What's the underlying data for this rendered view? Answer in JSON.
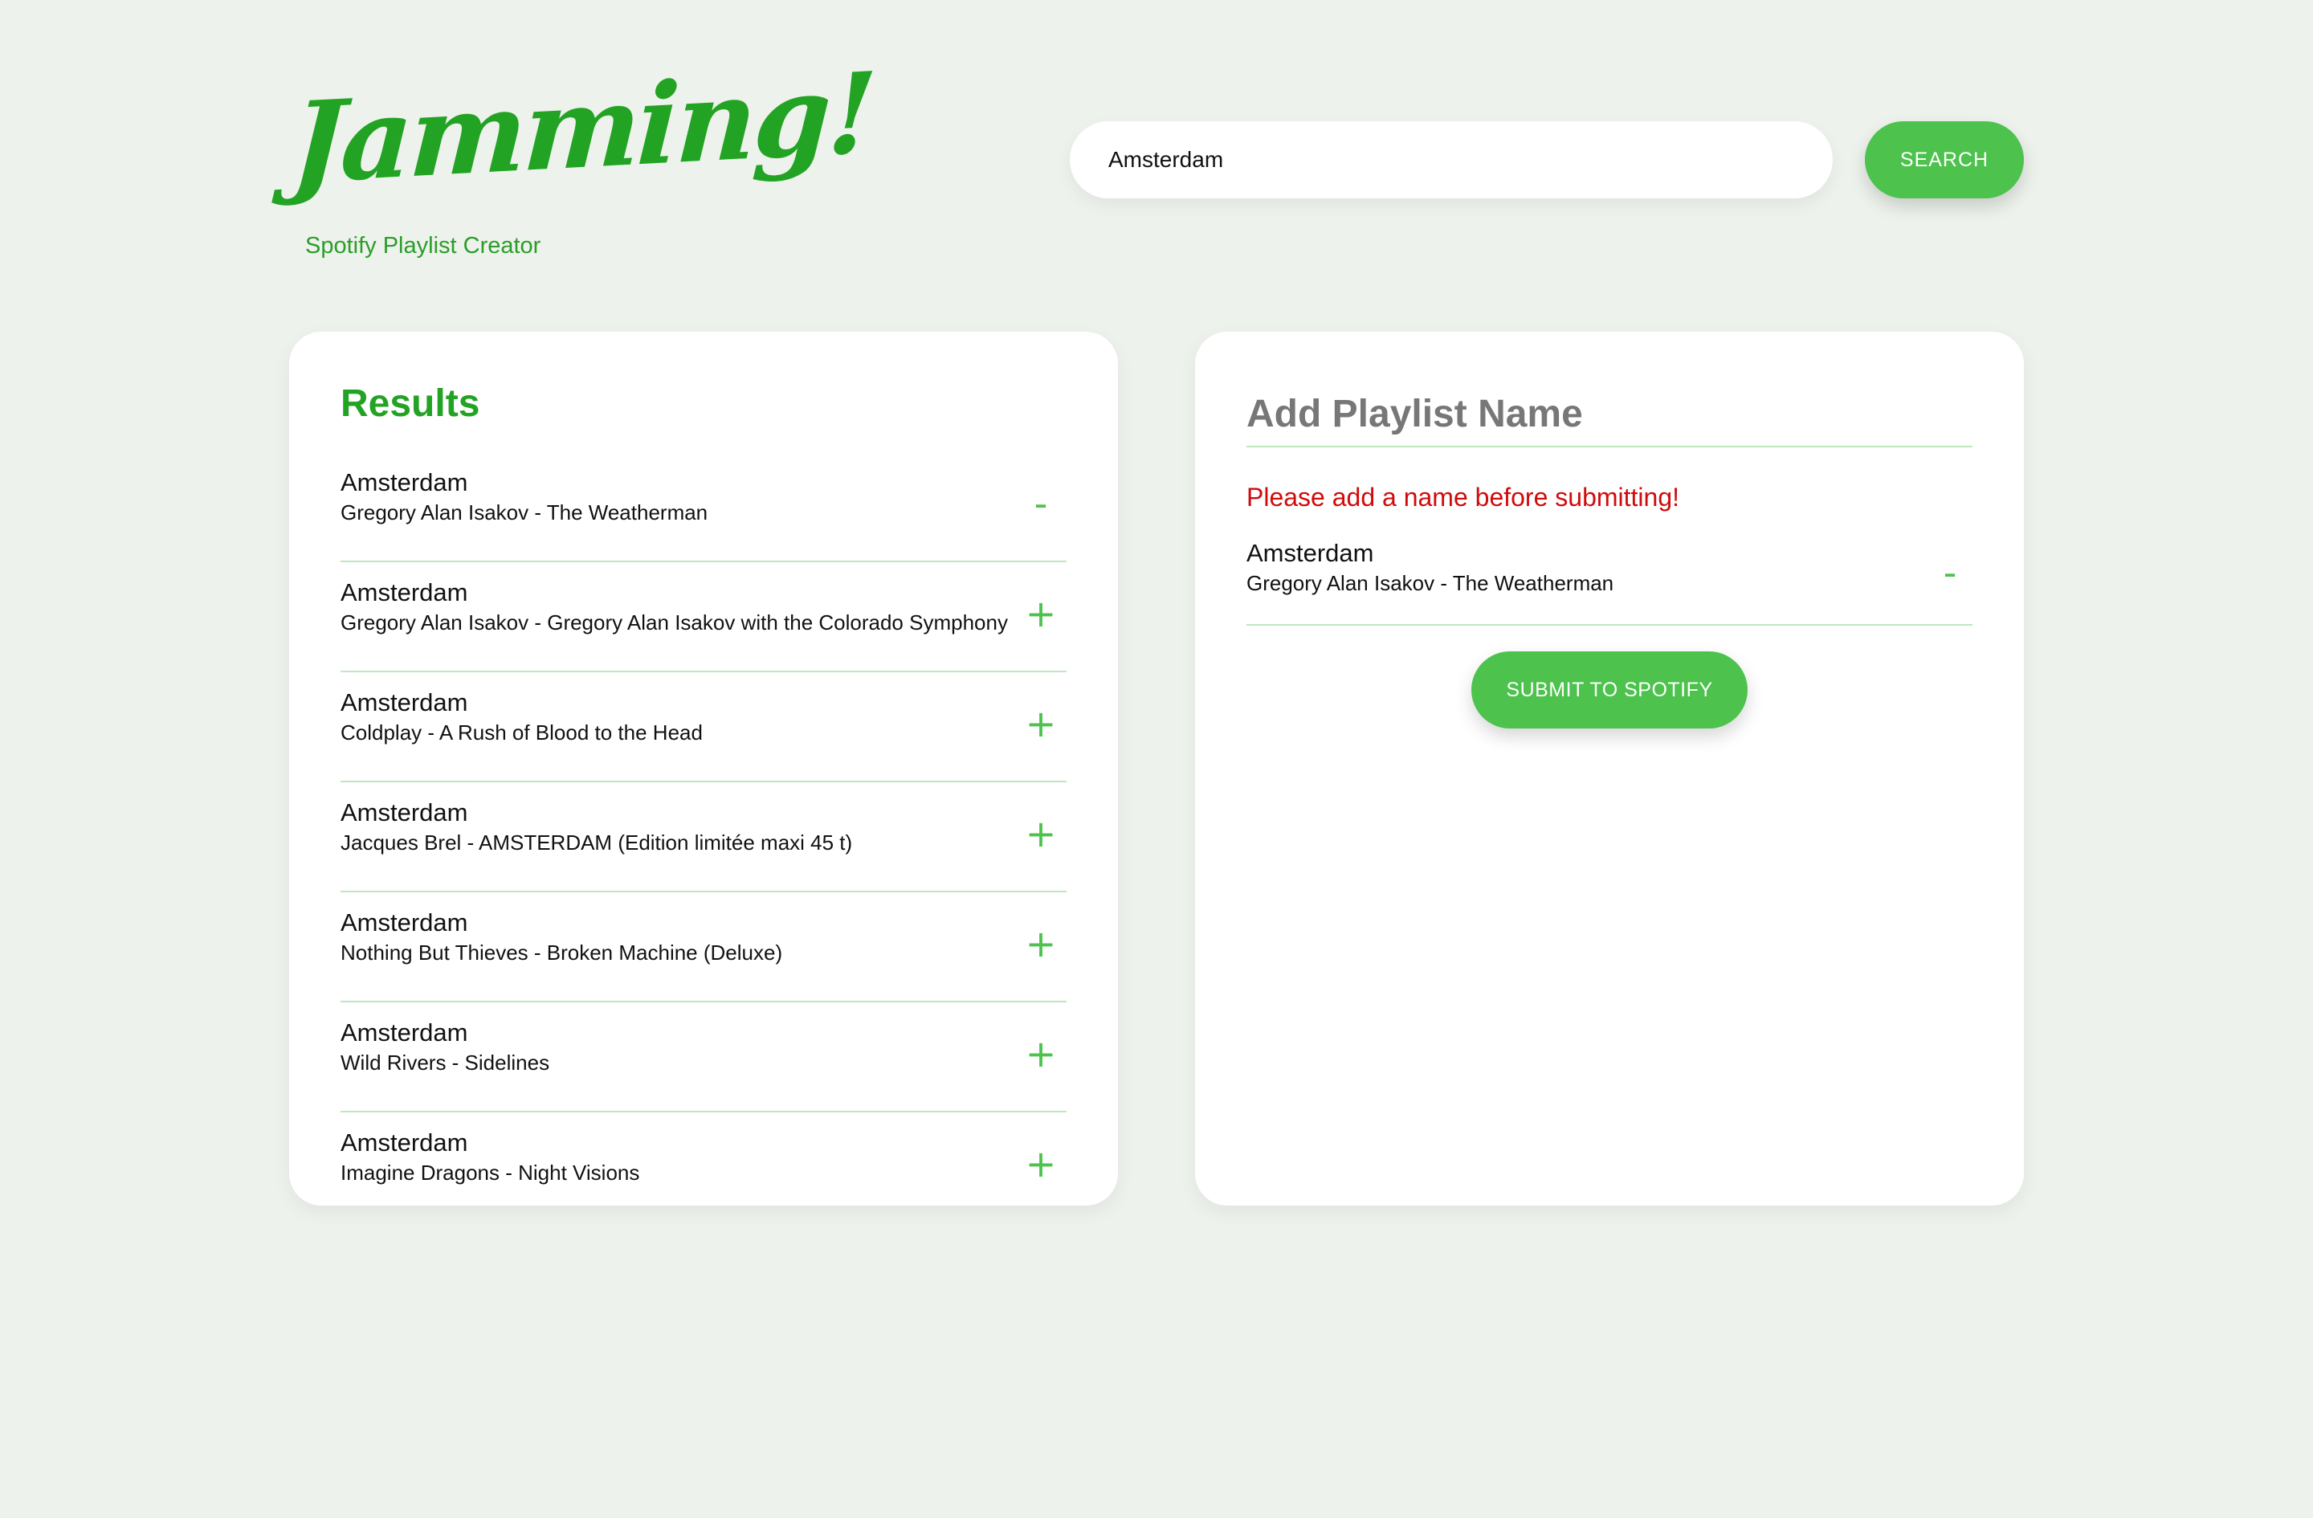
{
  "header": {
    "logo": "Jamming!",
    "tagline": "Spotify Playlist Creator"
  },
  "search": {
    "value": "Amsterdam",
    "button_label": "SEARCH"
  },
  "results": {
    "title": "Results",
    "tracks": [
      {
        "name": "Amsterdam",
        "detail": "Gregory Alan Isakov - The Weatherman",
        "action": "-"
      },
      {
        "name": "Amsterdam",
        "detail": "Gregory Alan Isakov - Gregory Alan Isakov with the Colorado Symphony",
        "action": "+"
      },
      {
        "name": "Amsterdam",
        "detail": "Coldplay - A Rush of Blood to the Head",
        "action": "+"
      },
      {
        "name": "Amsterdam",
        "detail": "Jacques Brel - AMSTERDAM (Edition limitée maxi 45 t)",
        "action": "+"
      },
      {
        "name": "Amsterdam",
        "detail": "Nothing But Thieves - Broken Machine (Deluxe)",
        "action": "+"
      },
      {
        "name": "Amsterdam",
        "detail": "Wild Rivers - Sidelines",
        "action": "+"
      },
      {
        "name": "Amsterdam",
        "detail": "Imagine Dragons - Night Visions",
        "action": "+"
      }
    ]
  },
  "playlist": {
    "name_placeholder": "Add Playlist Name",
    "error": "Please add a name before submitting!",
    "tracks": [
      {
        "name": "Amsterdam",
        "detail": "Gregory Alan Isakov - The Weatherman",
        "action": "-"
      }
    ],
    "submit_label": "SUBMIT TO SPOTIFY"
  },
  "colors": {
    "brand_green": "#23a323",
    "button_green": "#4dc24d",
    "error_red": "#d10a0a",
    "background": "#eef2ec"
  }
}
